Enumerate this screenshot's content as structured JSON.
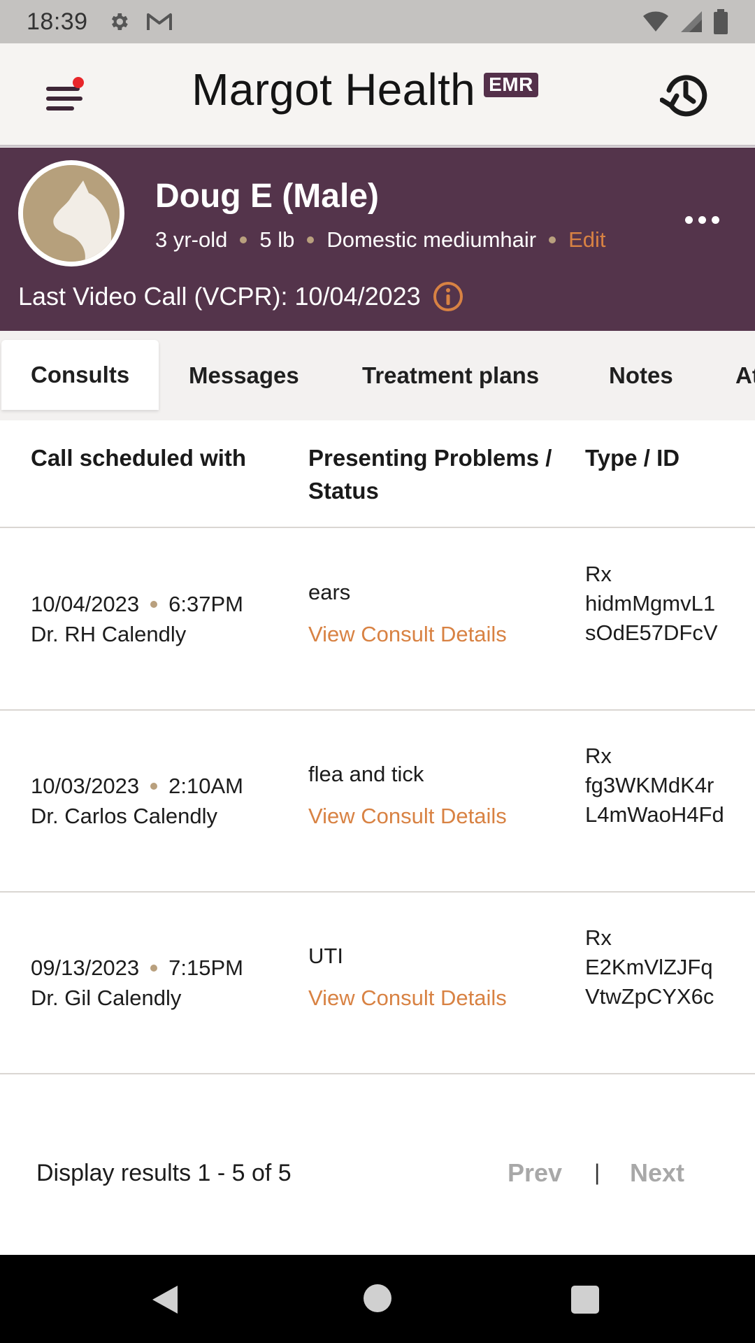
{
  "status_bar": {
    "time": "18:39",
    "icons": [
      "settings-icon",
      "gmail-icon",
      "wifi-icon",
      "signal-icon",
      "battery-icon"
    ]
  },
  "header": {
    "brand": "Margot Health",
    "badge": "EMR",
    "menu_icon": "menu-icon",
    "history_icon": "history-icon",
    "notification_dot_color": "#e8262a"
  },
  "patient": {
    "name": "Doug E (Male)",
    "age": "3 yr-old",
    "weight": "5 lb",
    "breed": "Domestic mediumhair",
    "edit_label": "Edit",
    "last_call_label": "Last Video Call (VCPR): 10/04/2023",
    "avatar_icon": "cat-avatar-icon"
  },
  "tabs": [
    {
      "label": "Consults",
      "active": true
    },
    {
      "label": "Messages",
      "active": false
    },
    {
      "label": "Treatment plans",
      "active": false
    },
    {
      "label": "Notes",
      "active": false
    },
    {
      "label": "At",
      "active": false
    }
  ],
  "table": {
    "headers": {
      "when": "Call scheduled with",
      "problem_line1": "Presenting Problems /",
      "problem_line2": "Status",
      "type": "Type / ID"
    },
    "rows": [
      {
        "date": "10/04/2023",
        "time": "6:37PM",
        "doctor": "Dr. RH Calendly",
        "problem": "ears",
        "link": "View Consult Details",
        "type": "Rx",
        "id": "hidmMgmvL1sOdE57DFcV"
      },
      {
        "date": "10/03/2023",
        "time": "2:10AM",
        "doctor": "Dr. Carlos Calendly",
        "problem": "flea and tick",
        "link": "View Consult Details",
        "type": "Rx",
        "id": "fg3WKMdK4rL4mWaoH4Fd"
      },
      {
        "date": "09/13/2023",
        "time": "7:15PM",
        "doctor": "Dr. Gil Calendly",
        "problem": "UTI",
        "link": "View Consult Details",
        "type": "Rx",
        "id": "E2KmVlZJFqVtwZpCYX6c"
      }
    ]
  },
  "pagination": {
    "results": "Display results 1 - 5 of 5",
    "prev": "Prev",
    "separator": "|",
    "next": "Next"
  },
  "colors": {
    "banner": "#54344b",
    "accent": "#d88243",
    "badge": "#54304a"
  }
}
